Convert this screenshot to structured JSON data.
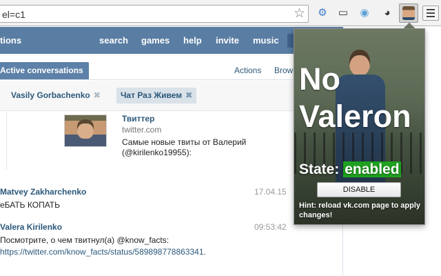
{
  "browser": {
    "url": "el=c1",
    "icons": [
      "star-icon",
      "gear-extension-icon",
      "cast-icon",
      "camera-icon",
      "panda-icon",
      "no-valeron-extension-icon",
      "menu-icon"
    ]
  },
  "nav": {
    "items": [
      "tions",
      "search",
      "games",
      "help",
      "invite",
      "music"
    ]
  },
  "tabs": {
    "active": "Active conversations",
    "actions": "Actions",
    "browse": "Brow"
  },
  "chips": [
    "Vasily Gorbachenko",
    "Чат Раз Живем"
  ],
  "link_preview": {
    "title": "Твиттер",
    "domain": "twitter.com",
    "description": "Самые новые твиты от Валерий (@kirilenko19955):"
  },
  "messages": [
    {
      "author": "Matvey Zakharchenko",
      "time": "17.04.15",
      "text": "еБАТЬ КОПАТЬ"
    },
    {
      "author": "Valera Kirilenko",
      "time": "09:53:42",
      "text": "Посмотрите, о чем твитнул(а) @know_facts:",
      "link": "https://twitter.com/know_facts/status/589898778863341."
    }
  ],
  "popup": {
    "title": "No Valeron",
    "state_label": "State:",
    "state_value": "enabled",
    "button": "DISABLE",
    "hint": "Hint: reload vk.com page to apply changes!"
  },
  "colors": {
    "vk_header": "#597da3",
    "vk_link": "#2b587a",
    "state_enabled": "#1ea11e"
  }
}
